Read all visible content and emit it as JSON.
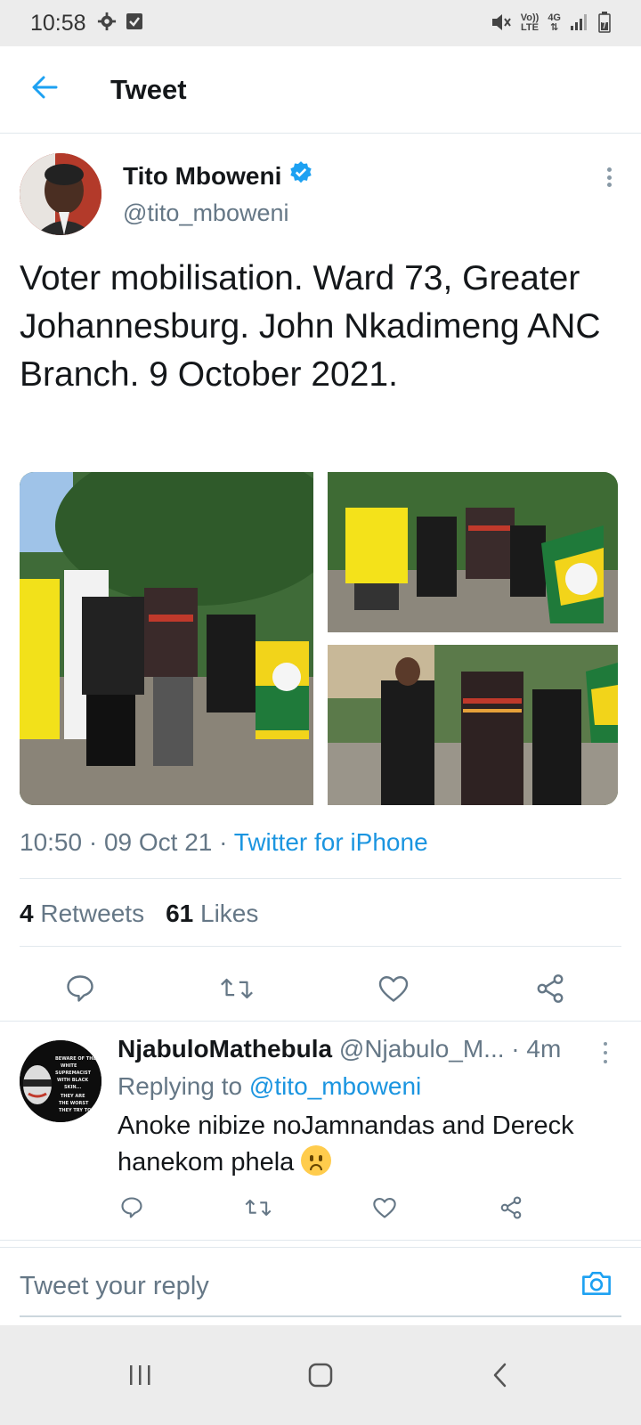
{
  "status_bar": {
    "time": "10:58",
    "volte": "Vo))",
    "lte": "LTE",
    "network": "4G"
  },
  "header": {
    "title": "Tweet"
  },
  "tweet": {
    "author_name": "Tito Mboweni",
    "author_handle": "@tito_mboweni",
    "verified": true,
    "text": "Voter mobilisation. Ward 73, Greater Johannesburg. John Nkadimeng ANC Branch. 9 October 2021.",
    "time": "10:50",
    "date": "09 Oct 21",
    "source": "Twitter for iPhone",
    "retweets_count": "4",
    "retweets_label": "Retweets",
    "likes_count": "61",
    "likes_label": "Likes",
    "image_count": 3
  },
  "reply": {
    "name": "NjabuloMathebula",
    "handle": "@Njabulo_M...",
    "time": "4m",
    "replying_to_label": "Replying to",
    "replying_to_handle": "@tito_mboweni",
    "text": "Anoke nibize noJamnandas and Dereck hanekom phela",
    "avatar_text": "BEWARE OF THE WHITE SUPREMACIST WITH BLACK SKIN... THEY ARE THE WORST THEY TRY TO HIDE EVERYTHING AMONG"
  },
  "reply_box": {
    "placeholder": "Tweet your reply"
  },
  "colors": {
    "accent": "#1da1f2",
    "link": "#1b95e0",
    "secondary_text": "#657786",
    "primary_text": "#14171a"
  },
  "icons": {
    "back": "arrow-left-icon",
    "verified": "verified-badge-icon",
    "reply": "speech-bubble-icon",
    "retweet": "retweet-icon",
    "like": "heart-icon",
    "share": "share-icon",
    "camera": "camera-icon"
  }
}
